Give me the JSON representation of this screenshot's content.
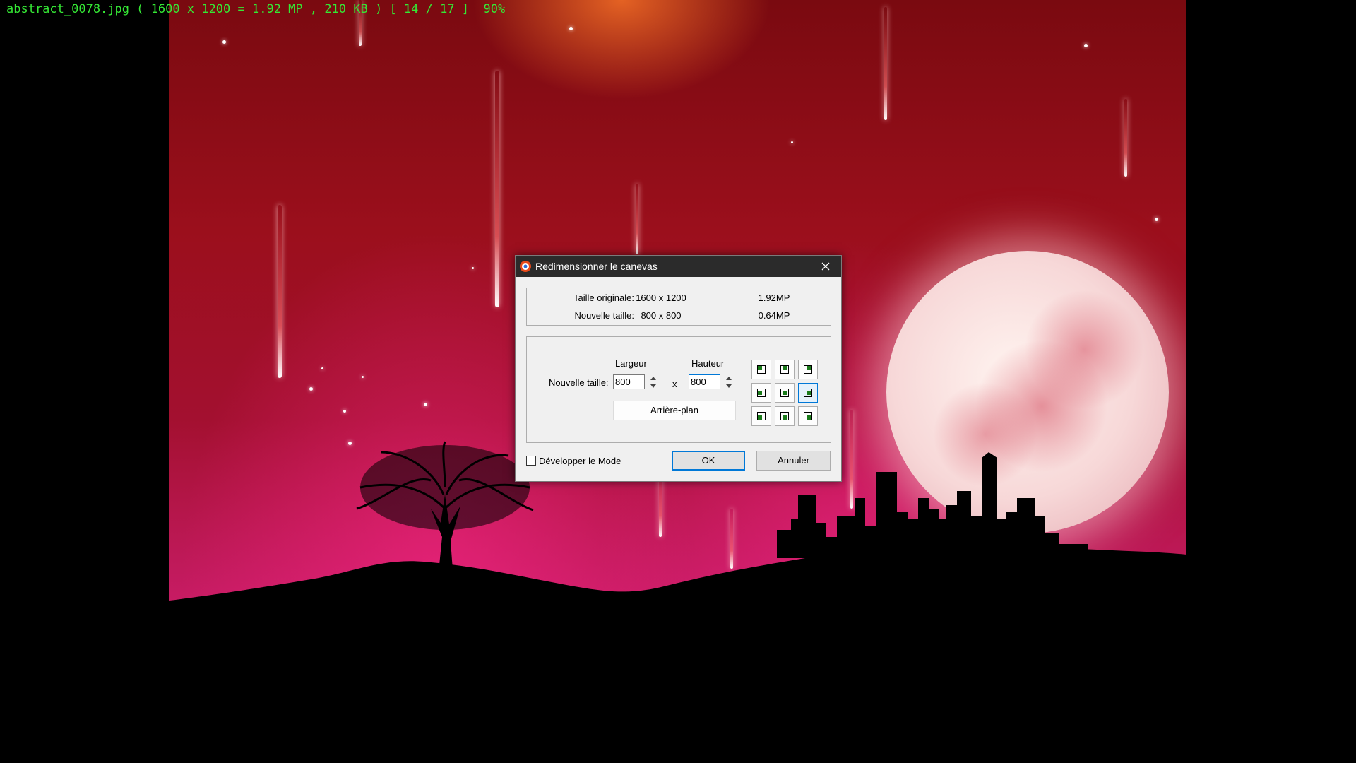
{
  "status_bar": {
    "text": "abstract_0078.jpg ( 1600 x 1200 = 1.92 MP , 210 KB ) [ 14 / 17 ]  90%"
  },
  "dialog": {
    "title": "Redimensionner le canevas",
    "info": {
      "original_label": "Taille originale:",
      "original_dims": "1600 x 1200",
      "original_mp": "1.92MP",
      "new_label": "Nouvelle taille:",
      "new_dims": "800 x 800",
      "new_mp": "0.64MP"
    },
    "size": {
      "width_caption": "Largeur",
      "height_caption": "Hauteur",
      "new_size_label": "Nouvelle taille:",
      "width_value": "800",
      "height_value": "800",
      "separator": "x",
      "background_button": "Arrière-plan"
    },
    "anchor": {
      "selected": "middle-right"
    },
    "expand_mode_label": "Développer le Mode",
    "expand_mode_checked": false,
    "ok_label": "OK",
    "cancel_label": "Annuler"
  },
  "colors": {
    "status_text": "#35e835",
    "title_bar": "#2b2b2b",
    "accent": "#0078d7",
    "anchor_marker": "#1a7a1a"
  }
}
